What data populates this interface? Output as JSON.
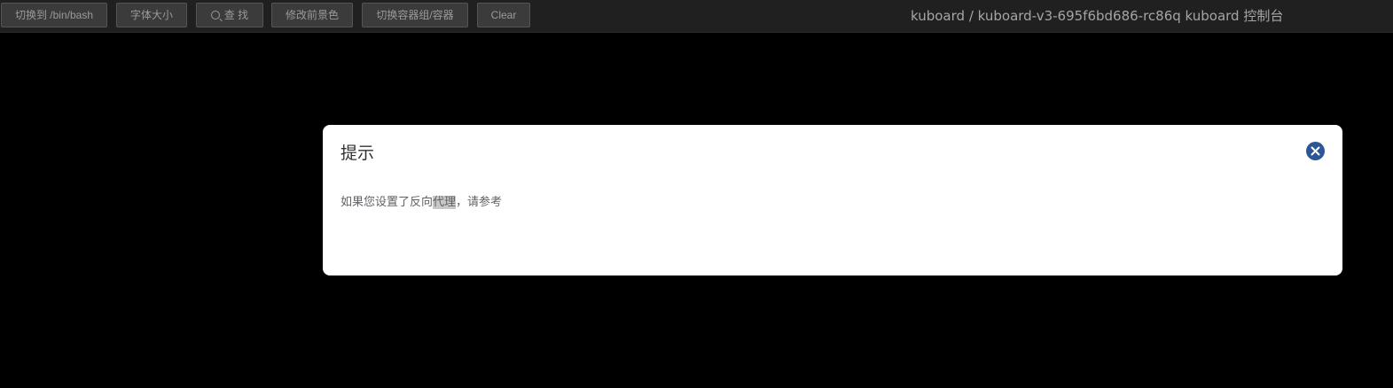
{
  "toolbar": {
    "buttons": [
      {
        "label": "切换到 /bin/bash"
      },
      {
        "label": "字体大小"
      },
      {
        "label": "查 找",
        "icon": "search-icon"
      },
      {
        "label": "修改前景色"
      },
      {
        "label": "切换容器组/容器"
      },
      {
        "label": "Clear"
      }
    ],
    "title": "kuboard / kuboard-v3-695f6bd686-rc86q kuboard 控制台"
  },
  "dialog": {
    "title": "提示",
    "close_icon": "close-circle-icon",
    "message_before": "如果您设置了反向",
    "message_highlight": "代理",
    "message_after": "，请参考"
  },
  "colors": {
    "toolbar_bg": "#202020",
    "button_bg": "#3b3b3b",
    "terminal_bg": "#000000",
    "dialog_bg": "#ffffff",
    "close_icon": "#2b5797"
  }
}
